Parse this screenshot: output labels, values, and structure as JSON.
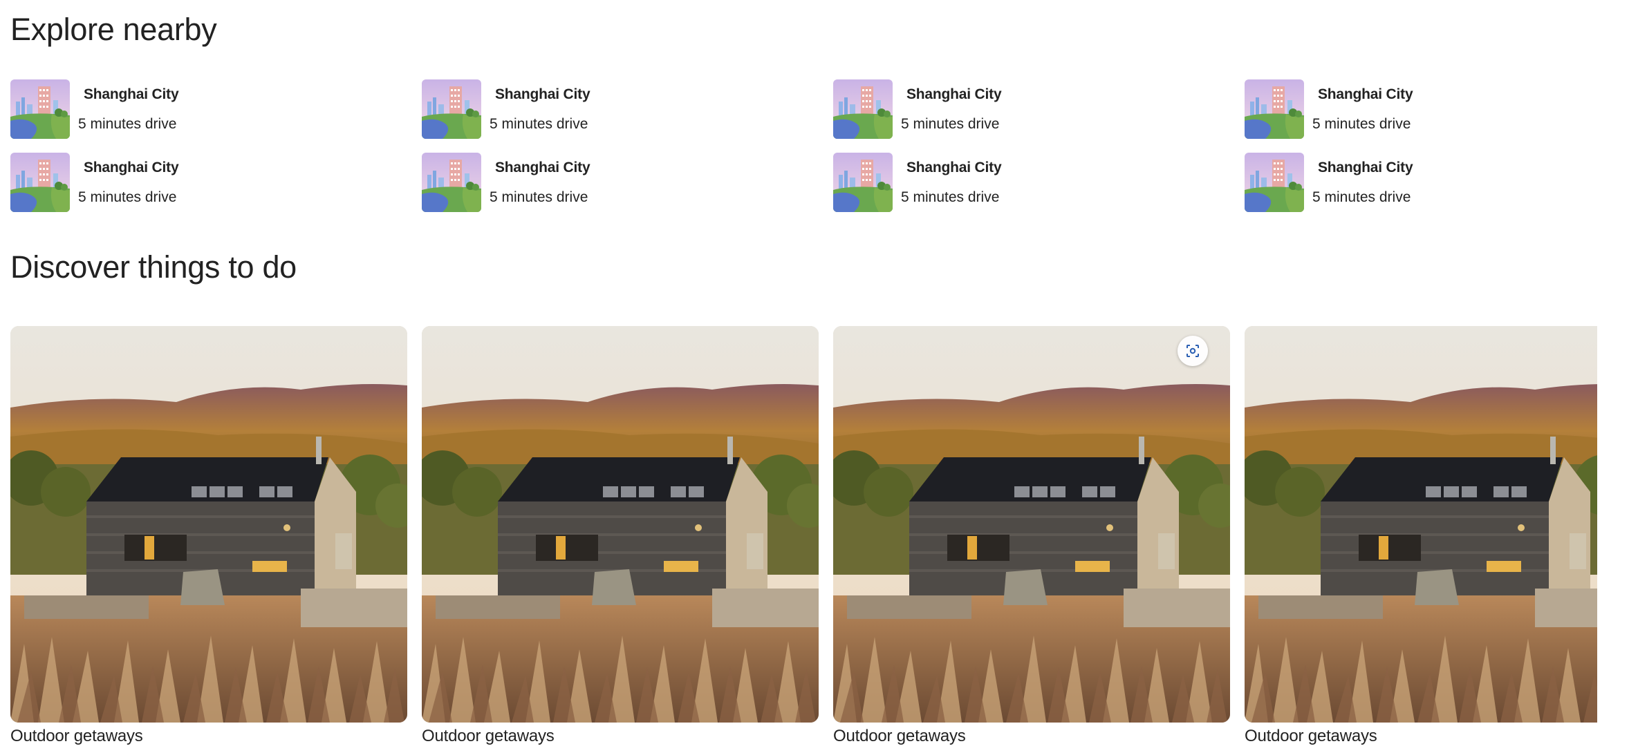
{
  "explore": {
    "title": "Explore nearby",
    "items": [
      {
        "name": "Shanghai City",
        "distance": "5 minutes drive"
      },
      {
        "name": "Shanghai City",
        "distance": "5 minutes drive"
      },
      {
        "name": "Shanghai City",
        "distance": "5 minutes drive"
      },
      {
        "name": "Shanghai City",
        "distance": "5 minutes drive"
      },
      {
        "name": "Shanghai City",
        "distance": "5 minutes drive"
      },
      {
        "name": "Shanghai City",
        "distance": "5 minutes drive"
      },
      {
        "name": "Shanghai City",
        "distance": "5 minutes drive"
      },
      {
        "name": "Shanghai City",
        "distance": "5 minutes drive"
      }
    ]
  },
  "discover": {
    "title": "Discover things to do",
    "cards": [
      {
        "caption": "Outdoor getaways"
      },
      {
        "caption": "Outdoor getaways"
      },
      {
        "caption": "Outdoor getaways"
      },
      {
        "caption": "Outdoor getaways"
      }
    ]
  },
  "icons": {
    "visual_search": "lens-icon"
  },
  "colors": {
    "text": "#222222",
    "background": "#ffffff",
    "lens_accent": "#2b5fb3"
  }
}
